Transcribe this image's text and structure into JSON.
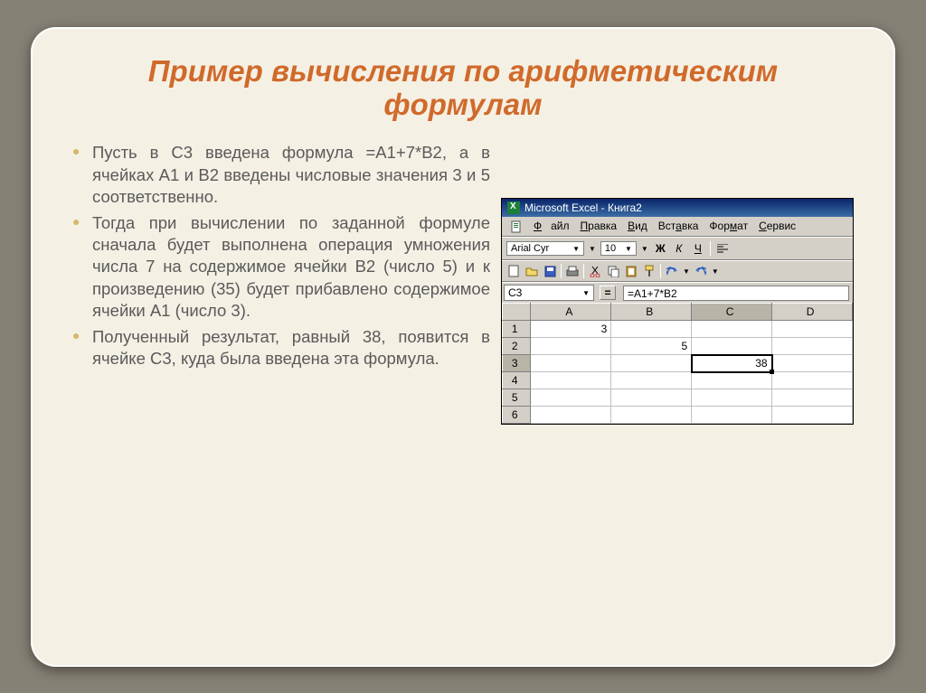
{
  "title": "Пример вычисления по арифметическим формулам",
  "bullets": [
    "Пусть в C3 введена формула =A1+7*B2, а в ячейках A1 и B2 введены числовые значения 3 и 5 соответственно.",
    "Тогда при вычислении по заданной формуле сначала будет выполнена операция умножения числа 7 на содержимое ячейки B2 (число 5) и к произведению (35) будет прибавлено содержимое ячейки A1 (число 3).",
    "Полученный результат, равный 38, появится в ячейке C3, куда была введена эта формула."
  ],
  "excel": {
    "window_title": "Microsoft Excel - Книга2",
    "menu": {
      "file": "Файл",
      "edit": "Правка",
      "view": "Вид",
      "insert": "Вставка",
      "format": "Формат",
      "service": "Сервис"
    },
    "font_name": "Arial Cyr",
    "font_size": "10",
    "fmt": {
      "bold": "Ж",
      "italic": "К",
      "underline": "Ч"
    },
    "name_box": "C3",
    "formula": "=A1+7*B2",
    "columns": [
      "A",
      "B",
      "C",
      "D"
    ],
    "rows": [
      "1",
      "2",
      "3",
      "4",
      "5",
      "6"
    ],
    "cells": {
      "A1": "3",
      "B2": "5",
      "C3": "38"
    },
    "selected": "C3"
  }
}
